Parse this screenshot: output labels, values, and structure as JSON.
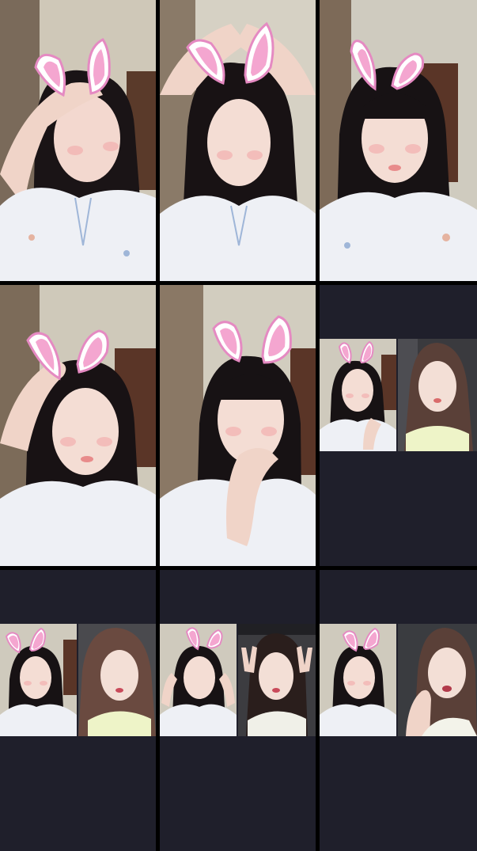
{
  "grid": {
    "rows": 3,
    "columns": 3,
    "tile_background": "#1f1f2b",
    "gap_color": "#000000"
  },
  "tiles": [
    {
      "kind": "single",
      "scene": "hand-on-head-eyes-closed",
      "ears": "bunny-ears-icon"
    },
    {
      "kind": "single",
      "scene": "both-hands-on-head",
      "ears": "bunny-ears-icon"
    },
    {
      "kind": "single",
      "scene": "bangs-centered",
      "ears": "bunny-ears-icon"
    },
    {
      "kind": "single",
      "scene": "hand-on-head-left",
      "ears": "bunny-ears-icon"
    },
    {
      "kind": "single",
      "scene": "hand-near-chin",
      "ears": "bunny-ears-icon"
    },
    {
      "kind": "duet",
      "left": "bunny-ears-icon",
      "right": "no-filter"
    },
    {
      "kind": "duet",
      "left": "bunny-ears-icon",
      "right": "no-filter"
    },
    {
      "kind": "duet",
      "left": "bunny-ears-icon",
      "right": "peace-sign"
    },
    {
      "kind": "duet",
      "left": "bunny-ears-icon",
      "right": "no-filter"
    }
  ]
}
